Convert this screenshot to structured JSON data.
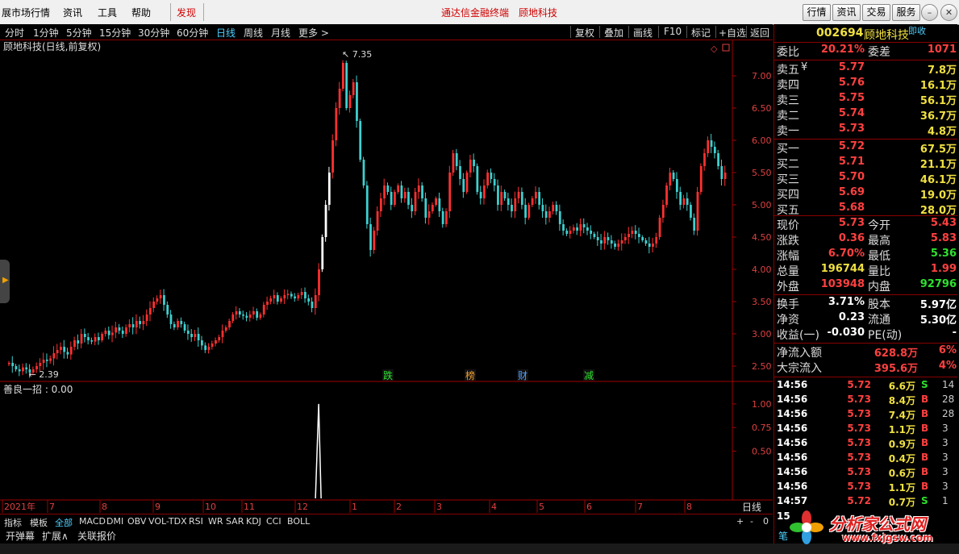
{
  "menu": {
    "items": [
      "展市场行情",
      "资讯",
      "工具",
      "帮助"
    ],
    "discover": "发现",
    "center_title": "通达信金融终端",
    "center_stock": "顾地科技",
    "right_buttons": [
      "行情",
      "资讯",
      "交易",
      "服务"
    ]
  },
  "periods": [
    "分时",
    "1分钟",
    "5分钟",
    "15分钟",
    "30分钟",
    "60分钟",
    "日线",
    "周线",
    "月线",
    "更多 >"
  ],
  "active_period": "日线",
  "tools": [
    "复权",
    "叠加",
    "画线",
    "F10",
    "标记",
    "+自选",
    "返回"
  ],
  "chart_title": "顾地科技(日线,前复权)",
  "indicator_title": "善良一招 : 0.00",
  "date_axis_label": "日线",
  "month_labels": [
    "2021年",
    "7",
    "8",
    "9",
    "10",
    "11",
    "12",
    "1",
    "2",
    "3",
    "4",
    "5",
    "6",
    "7",
    "8"
  ],
  "events": [
    "跌",
    "榜",
    "财",
    "减"
  ],
  "indicators": [
    "指标",
    "模板",
    "全部",
    "MACD",
    "DMI",
    "OBV",
    "VOL-TDX",
    "RSI",
    "WR",
    "SAR",
    "KDJ",
    "CCI",
    "BOLL"
  ],
  "active_indicator": "全部",
  "functions": [
    "开弹幕",
    "扩展∧",
    "关联报价"
  ],
  "zoom_controls": [
    "+",
    "-",
    "0"
  ],
  "colors": {
    "up": "#ff3030",
    "down": "#3fd0d0",
    "axis": "#a00000",
    "accent": "#4fd0ff"
  },
  "chart_data": {
    "type": "candlestick",
    "title": "顾地科技(日线,前复权)",
    "y_ticks": [
      "7.00",
      "6.50",
      "6.00",
      "5.50",
      "5.00",
      "4.50",
      "4.00",
      "3.50",
      "3.00",
      "2.50"
    ],
    "ylim": [
      2.3,
      7.5
    ],
    "annotations": {
      "high": "7.35",
      "low": "2.39"
    },
    "closes": [
      2.55,
      2.5,
      2.45,
      2.42,
      2.48,
      2.45,
      2.4,
      2.45,
      2.5,
      2.55,
      2.6,
      2.58,
      2.62,
      2.7,
      2.75,
      2.8,
      2.72,
      2.68,
      2.8,
      2.9,
      2.85,
      3.0,
      2.95,
      2.9,
      2.88,
      2.95,
      2.9,
      3.0,
      3.05,
      2.98,
      3.02,
      3.1,
      3.05,
      3.0,
      3.1,
      3.15,
      3.1,
      3.2,
      3.15,
      3.2,
      3.3,
      3.4,
      3.5,
      3.55,
      3.6,
      3.45,
      3.3,
      3.15,
      3.1,
      3.2,
      3.15,
      3.05,
      3.0,
      2.95,
      3.0,
      2.9,
      2.82,
      2.75,
      2.8,
      2.85,
      2.9,
      2.95,
      3.05,
      3.1,
      3.2,
      3.3,
      3.35,
      3.3,
      3.28,
      3.25,
      3.3,
      3.35,
      3.25,
      3.3,
      3.45,
      3.5,
      3.55,
      3.6,
      3.5,
      3.55,
      3.6,
      3.62,
      3.58,
      3.55,
      3.6,
      3.65,
      3.55,
      3.5,
      3.4,
      3.6,
      4.0,
      4.5,
      5.0,
      5.5,
      6.0,
      6.5,
      6.8,
      7.2,
      6.5,
      6.7,
      6.9,
      6.3,
      5.7,
      5.3,
      4.7,
      4.3,
      4.6,
      4.9,
      5.1,
      5.3,
      5.2,
      5.0,
      5.2,
      5.3,
      5.1,
      5.2,
      5.0,
      4.9,
      5.2,
      5.3,
      5.1,
      4.8,
      4.9,
      5.0,
      5.1,
      4.9,
      4.7,
      4.9,
      5.5,
      5.8,
      5.6,
      5.4,
      5.2,
      5.5,
      5.7,
      5.6,
      5.2,
      5.1,
      5.3,
      5.5,
      5.4,
      5.3,
      5.0,
      5.2,
      5.1,
      5.0,
      4.9,
      5.1,
      5.2,
      5.0,
      4.8,
      5.0,
      5.1,
      5.2,
      5.0,
      4.9,
      4.8,
      4.9,
      5.0,
      4.9,
      4.7,
      4.6,
      4.55,
      4.6,
      4.65,
      4.6,
      4.7,
      4.65,
      4.6,
      4.55,
      4.5,
      4.45,
      4.4,
      4.5,
      4.45,
      4.4,
      4.35,
      4.4,
      4.45,
      4.5,
      4.55,
      4.6,
      4.55,
      4.5,
      4.45,
      4.4,
      4.35,
      4.4,
      4.5,
      4.8,
      5.0,
      5.3,
      5.5,
      5.4,
      5.2,
      5.0,
      5.1,
      5.0,
      4.8,
      4.6,
      5.2,
      5.6,
      5.8,
      6.0,
      5.9,
      5.8,
      5.6,
      5.4,
      5.5
    ]
  },
  "indicator_data": {
    "y_ticks": [
      "1.00",
      "0.75",
      "0.50"
    ],
    "ylim": [
      0,
      1.05
    ],
    "signal_index": 90
  },
  "stock": {
    "code": "002694",
    "name": "顾地科技",
    "collapse": "即收"
  },
  "ratio": {
    "label": "委比",
    "value": "20.21%",
    "label2": "委差",
    "value2": "1071"
  },
  "asks": [
    {
      "label": "卖五",
      "price": "5.77",
      "vol": "7.8万"
    },
    {
      "label": "卖四",
      "price": "5.76",
      "vol": "16.1万"
    },
    {
      "label": "卖三",
      "price": "5.75",
      "vol": "56.1万"
    },
    {
      "label": "卖二",
      "price": "5.74",
      "vol": "36.7万"
    },
    {
      "label": "卖一",
      "price": "5.73",
      "vol": "4.8万"
    }
  ],
  "bids": [
    {
      "label": "买一",
      "price": "5.72",
      "vol": "67.5万"
    },
    {
      "label": "买二",
      "price": "5.71",
      "vol": "21.1万"
    },
    {
      "label": "买三",
      "price": "5.70",
      "vol": "46.1万"
    },
    {
      "label": "买四",
      "price": "5.69",
      "vol": "19.0万"
    },
    {
      "label": "买五",
      "price": "5.68",
      "vol": "28.0万"
    }
  ],
  "currency_mark": "¥",
  "quote": [
    {
      "l1": "现价",
      "v1": "5.73",
      "l2": "今开",
      "v2": "5.43",
      "c1": "red",
      "c2": "red"
    },
    {
      "l1": "涨跌",
      "v1": "0.36",
      "l2": "最高",
      "v2": "5.83",
      "c1": "red",
      "c2": "red"
    },
    {
      "l1": "涨幅",
      "v1": "6.70%",
      "l2": "最低",
      "v2": "5.36",
      "c1": "red",
      "c2": "green"
    },
    {
      "l1": "总量",
      "v1": "196744",
      "l2": "量比",
      "v2": "1.99",
      "c1": "yellow",
      "c2": "red"
    },
    {
      "l1": "外盘",
      "v1": "103948",
      "l2": "内盘",
      "v2": "92796",
      "c1": "red",
      "c2": "green"
    }
  ],
  "fundamentals": [
    {
      "l1": "换手",
      "v1": "3.71%",
      "l2": "股本",
      "v2": "5.97亿"
    },
    {
      "l1": "净资",
      "v1": "0.23",
      "l2": "流通",
      "v2": "5.30亿"
    },
    {
      "l1": "收益(一)",
      "v1": "-0.030",
      "l2": "PE(动)",
      "v2": "-"
    }
  ],
  "flows": [
    {
      "label": "净流入额",
      "value": "628.8万",
      "pct": "6%"
    },
    {
      "label": "大宗流入",
      "value": "395.6万",
      "pct": "4%"
    }
  ],
  "ticks": [
    {
      "time": "14:56",
      "price": "5.72",
      "vol": "6.6万",
      "bs": "S",
      "n": "14"
    },
    {
      "time": "14:56",
      "price": "5.73",
      "vol": "8.4万",
      "bs": "B",
      "n": "28"
    },
    {
      "time": "14:56",
      "price": "5.73",
      "vol": "7.4万",
      "bs": "B",
      "n": "28"
    },
    {
      "time": "14:56",
      "price": "5.73",
      "vol": "1.1万",
      "bs": "B",
      "n": "3"
    },
    {
      "time": "14:56",
      "price": "5.73",
      "vol": "0.9万",
      "bs": "B",
      "n": "3"
    },
    {
      "time": "14:56",
      "price": "5.73",
      "vol": "0.4万",
      "bs": "B",
      "n": "3"
    },
    {
      "time": "14:56",
      "price": "5.73",
      "vol": "0.6万",
      "bs": "B",
      "n": "3"
    },
    {
      "time": "14:56",
      "price": "5.73",
      "vol": "1.1万",
      "bs": "B",
      "n": "3"
    },
    {
      "time": "14:57",
      "price": "5.72",
      "vol": "0.7万",
      "bs": "S",
      "n": "1"
    }
  ],
  "tick_partial": "15",
  "bottom_tab": "笔",
  "watermark": {
    "title": "分析家公式网",
    "url": "www.fxjgsw.com"
  }
}
